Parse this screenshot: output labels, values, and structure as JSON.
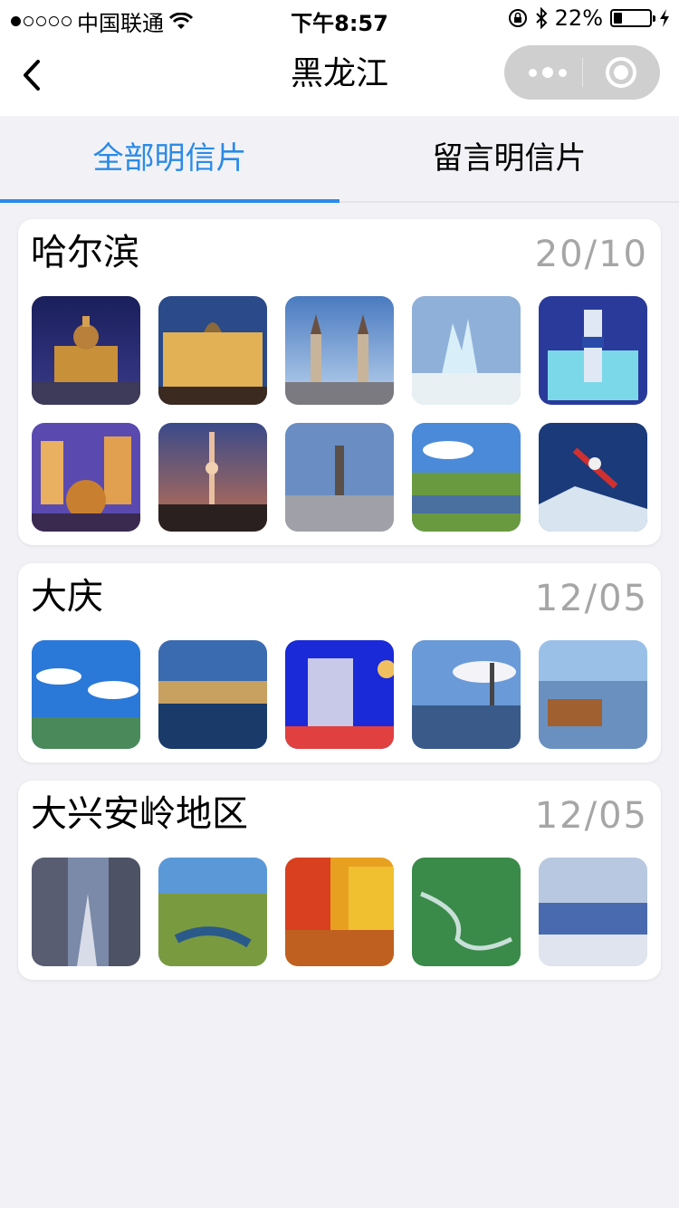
{
  "status": {
    "carrier": "中国联通",
    "time": "下午8:57",
    "battery": "22%",
    "signal_dots_filled": 1,
    "signal_dots_total": 5
  },
  "nav": {
    "title": "黑龙江"
  },
  "tabs": [
    {
      "label": "全部明信片",
      "active": true
    },
    {
      "label": "留言明信片",
      "active": false
    }
  ],
  "accent_color": "#2b8ae8",
  "cards": [
    {
      "city": "哈尔滨",
      "date": "20/10",
      "photo_count": 10
    },
    {
      "city": "大庆",
      "date": "12/05",
      "photo_count": 5
    },
    {
      "city": "大兴安岭地区",
      "date": "12/05",
      "photo_count": 5
    }
  ]
}
